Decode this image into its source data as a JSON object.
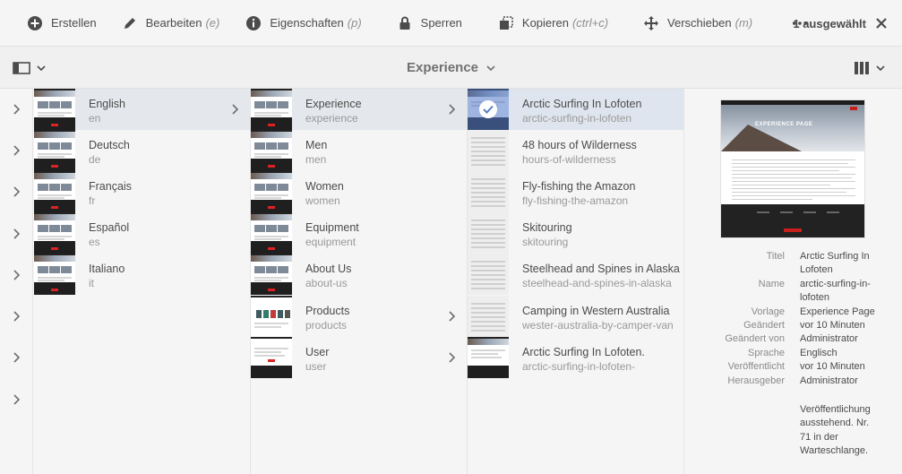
{
  "toolbar": {
    "create": "Erstellen",
    "edit": "Bearbeiten",
    "edit_shortcut": "(e)",
    "properties": "Eigenschaften",
    "properties_shortcut": "(p)",
    "lock": "Sperren",
    "copy": "Kopieren",
    "copy_shortcut": "(ctrl+c)",
    "move": "Verschieben",
    "move_shortcut": "(m)",
    "selected": "1 ausgewählt"
  },
  "subbar": {
    "title": "Experience"
  },
  "languages": [
    {
      "title": "English",
      "name": "en"
    },
    {
      "title": "Deutsch",
      "name": "de"
    },
    {
      "title": "Français",
      "name": "fr"
    },
    {
      "title": "Español",
      "name": "es"
    },
    {
      "title": "Italiano",
      "name": "it"
    }
  ],
  "sections": [
    {
      "title": "Experience",
      "name": "experience"
    },
    {
      "title": "Men",
      "name": "men"
    },
    {
      "title": "Women",
      "name": "women"
    },
    {
      "title": "Equipment",
      "name": "equipment"
    },
    {
      "title": "About Us",
      "name": "about-us"
    },
    {
      "title": "Products",
      "name": "products"
    },
    {
      "title": "User",
      "name": "user"
    }
  ],
  "pages": [
    {
      "title": "Arctic Surfing In Lofoten",
      "name": "arctic-surfing-in-lofoten"
    },
    {
      "title": "48 hours of Wilderness",
      "name": "hours-of-wilderness"
    },
    {
      "title": "Fly-fishing the Amazon",
      "name": "fly-fishing-the-amazon"
    },
    {
      "title": "Skitouring",
      "name": "skitouring"
    },
    {
      "title": "Steelhead and Spines in Alaska",
      "name": "steelhead-and-spines-in-alaska"
    },
    {
      "title": "Camping in Western Australia",
      "name": "wester-australia-by-camper-van"
    },
    {
      "title": "Arctic Surfing In Lofoten.",
      "name": "arctic-surfing-in-lofoten-"
    }
  ],
  "preview": {
    "hero_title": "EXPERIENCE PAGE"
  },
  "details": {
    "title_label": "Titel",
    "title_value": "Arctic Surfing In Lofoten",
    "name_label": "Name",
    "name_value": "arctic-surfing-in-lofoten",
    "template_label": "Vorlage",
    "template_value": "Experience Page",
    "modified_label": "Geändert",
    "modified_value": "vor 10 Minuten",
    "modified_by_label": "Geändert von",
    "modified_by_value": "Administrator",
    "language_label": "Sprache",
    "language_value": "Englisch",
    "published_label": "Veröffentlicht",
    "published_value": "vor 10 Minuten",
    "publisher_label": "Herausgeber",
    "publisher_value": "Administrator",
    "publication_note": "Veröffentlichung ausstehend. Nr. 71 in der Warteschlange."
  }
}
